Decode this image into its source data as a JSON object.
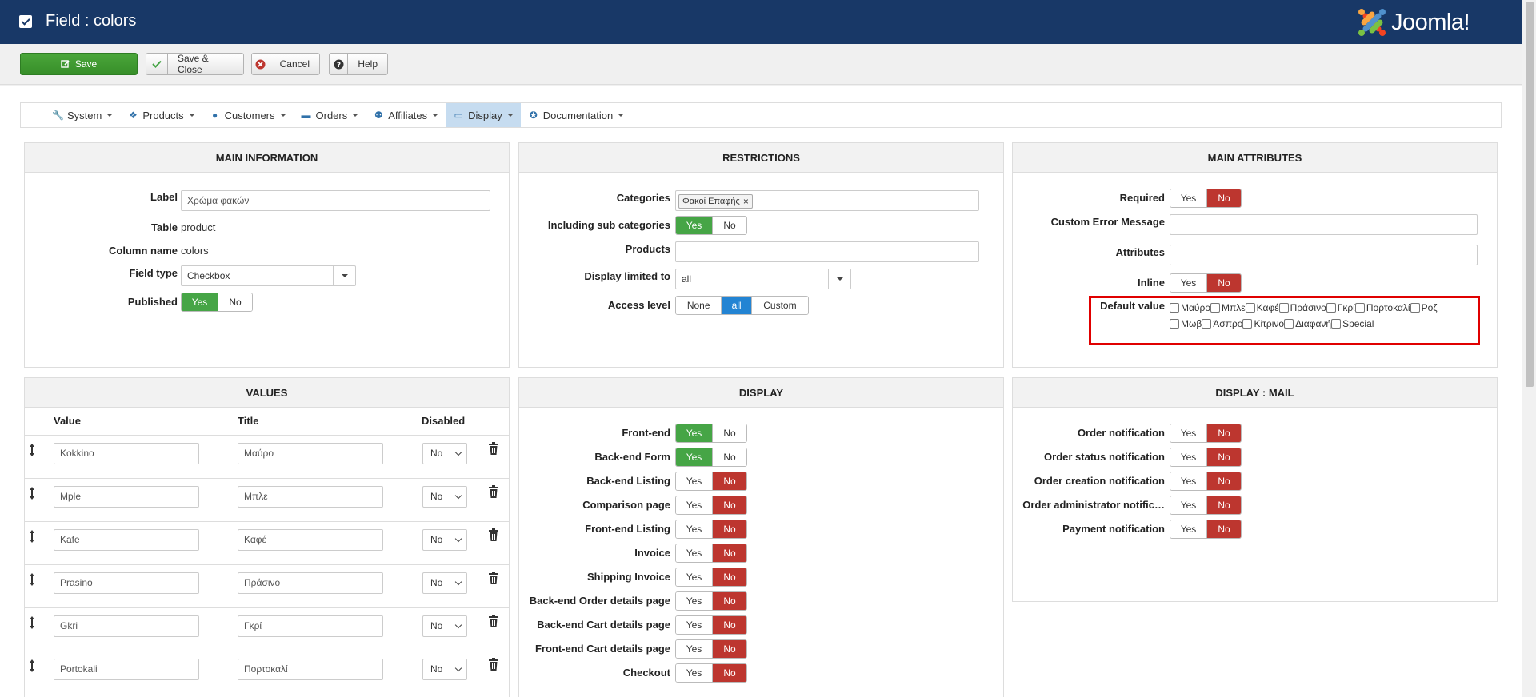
{
  "header": {
    "title": "Field : colors",
    "logo_text": "Joomla!"
  },
  "toolbar": {
    "save_label": "Save",
    "save_close_label": "Save & Close",
    "cancel_label": "Cancel",
    "help_label": "Help"
  },
  "nav": {
    "items": [
      {
        "label": "System",
        "icon": "wrench-icon"
      },
      {
        "label": "Products",
        "icon": "cubes-icon"
      },
      {
        "label": "Customers",
        "icon": "user-icon"
      },
      {
        "label": "Orders",
        "icon": "credit-card-icon"
      },
      {
        "label": "Affiliates",
        "icon": "users-icon"
      },
      {
        "label": "Display",
        "icon": "monitor-icon",
        "active": true
      },
      {
        "label": "Documentation",
        "icon": "lifebuoy-icon"
      }
    ]
  },
  "main_info": {
    "heading": "MAIN INFORMATION",
    "label_label": "Label",
    "label_value": "Χρώμα φακών",
    "table_label": "Table",
    "table_value": "product",
    "column_label": "Column name",
    "column_value": "colors",
    "field_type_label": "Field type",
    "field_type_value": "Checkbox",
    "published_label": "Published",
    "yes": "Yes",
    "no": "No"
  },
  "restrictions": {
    "heading": "RESTRICTIONS",
    "categories_label": "Categories",
    "category_chip": "Φακοί Επαφής",
    "chip_remove": "×",
    "subcat_label": "Including sub categories",
    "products_label": "Products",
    "display_limited_label": "Display limited to",
    "display_limited_value": "all",
    "access_label": "Access level",
    "access_none": "None",
    "access_all": "all",
    "access_custom": "Custom",
    "yes": "Yes",
    "no": "No"
  },
  "main_attributes": {
    "heading": "MAIN ATTRIBUTES",
    "required_label": "Required",
    "custom_error_label": "Custom Error Message",
    "attributes_label": "Attributes",
    "inline_label": "Inline",
    "default_value_label": "Default value",
    "yes": "Yes",
    "no": "No",
    "options_row1": [
      "Μαύρο",
      "Μπλε",
      "Καφέ",
      "Πράσινο",
      "Γκρί",
      "Πορτοκαλί",
      "Ροζ"
    ],
    "options_row2": [
      "Μωβ",
      "Άσπρο",
      "Κίτρινο",
      "Διαφανή",
      "Special"
    ]
  },
  "values": {
    "heading": "VALUES",
    "col_value": "Value",
    "col_title": "Title",
    "col_disabled": "Disabled",
    "rows": [
      {
        "value": "Kokkino",
        "title": "Μαύρο",
        "disabled": "No"
      },
      {
        "value": "Mple",
        "title": "Μπλε",
        "disabled": "No"
      },
      {
        "value": "Kafe",
        "title": "Καφέ",
        "disabled": "No"
      },
      {
        "value": "Prasino",
        "title": "Πράσινο",
        "disabled": "No"
      },
      {
        "value": "Gkri",
        "title": "Γκρί",
        "disabled": "No"
      },
      {
        "value": "Portokali",
        "title": "Πορτοκαλί",
        "disabled": "No"
      }
    ]
  },
  "display": {
    "heading": "DISPLAY",
    "yes": "Yes",
    "no": "No",
    "rows": [
      {
        "label": "Front-end",
        "state": "yes"
      },
      {
        "label": "Back-end Form",
        "state": "yes"
      },
      {
        "label": "Back-end Listing",
        "state": "no"
      },
      {
        "label": "Comparison page",
        "state": "no"
      },
      {
        "label": "Front-end Listing",
        "state": "no"
      },
      {
        "label": "Invoice",
        "state": "no"
      },
      {
        "label": "Shipping Invoice",
        "state": "no"
      },
      {
        "label": "Back-end Order details page",
        "state": "no"
      },
      {
        "label": "Back-end Cart details page",
        "state": "no"
      },
      {
        "label": "Front-end Cart details page",
        "state": "no"
      },
      {
        "label": "Checkout",
        "state": "no"
      }
    ]
  },
  "display_mail": {
    "heading": "DISPLAY : MAIL",
    "yes": "Yes",
    "no": "No",
    "rows": [
      {
        "label": "Order notification",
        "state": "no"
      },
      {
        "label": "Order status notification",
        "state": "no"
      },
      {
        "label": "Order creation notification",
        "state": "no"
      },
      {
        "label": "Order administrator notific…",
        "state": "no"
      },
      {
        "label": "Payment notification",
        "state": "no"
      }
    ]
  },
  "colors": {
    "header_bg": "#183867",
    "save_green": "#46a546",
    "yes_green": "#46a546",
    "no_red": "#bd362f",
    "active_blue": "#2384d3",
    "highlight_red": "#e00000"
  }
}
